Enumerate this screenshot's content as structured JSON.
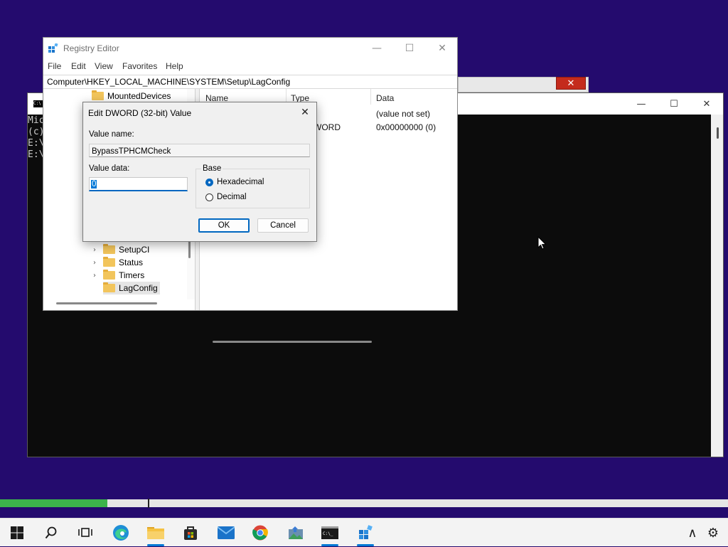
{
  "console": {
    "title_icon": "cmd-icon",
    "controls": {
      "minimize": "—",
      "maximize": "☐",
      "close": "✕"
    },
    "lines": [
      "Mic",
      "(c)",
      "",
      "E:\\",
      "",
      "E:\\"
    ]
  },
  "regedit": {
    "title": "Registry Editor",
    "controls": {
      "minimize": "—",
      "maximize": "☐",
      "close": "✕"
    },
    "menu": [
      "File",
      "Edit",
      "View",
      "Favorites",
      "Help"
    ],
    "address": "Computer\\HKEY_LOCAL_MACHINE\\SYSTEM\\Setup\\LagConfig",
    "tree": [
      {
        "label": "MountedDevices",
        "expandable": false
      },
      {
        "label": "SetupCI",
        "expandable": true
      },
      {
        "label": "Status",
        "expandable": true
      },
      {
        "label": "Timers",
        "expandable": true
      },
      {
        "label": "LagConfig",
        "expandable": false,
        "selected": true
      }
    ],
    "columns": [
      "Name",
      "Type",
      "Data"
    ],
    "rows": [
      {
        "type": "",
        "data": "(value not set)"
      },
      {
        "type": "WORD",
        "data": "0x00000000 (0)"
      }
    ]
  },
  "dialog": {
    "title": "Edit DWORD (32-bit) Value",
    "value_name_label": "Value name:",
    "value_name": "BypassTPHCMCheck",
    "value_data_label": "Value data:",
    "value_data": "0",
    "base_label": "Base",
    "base_options": [
      {
        "label": "Hexadecimal",
        "selected": true
      },
      {
        "label": "Decimal",
        "selected": false
      }
    ],
    "ok_label": "OK",
    "cancel_label": "Cancel"
  },
  "progress": {
    "fraction": 0.147
  },
  "taskbar": {
    "items": [
      "start-icon",
      "search-icon",
      "task-view-icon",
      "edge-icon",
      "file-explorer-icon",
      "store-icon",
      "mail-icon",
      "chrome-icon",
      "image-app-icon",
      "terminal-icon",
      "registry-editor-icon"
    ],
    "tray": {
      "chevron": "∧",
      "gear": "⚙"
    }
  },
  "colors": {
    "desktop": "#240b6e",
    "accent": "#0067c0",
    "progress": "#3cb44b"
  }
}
